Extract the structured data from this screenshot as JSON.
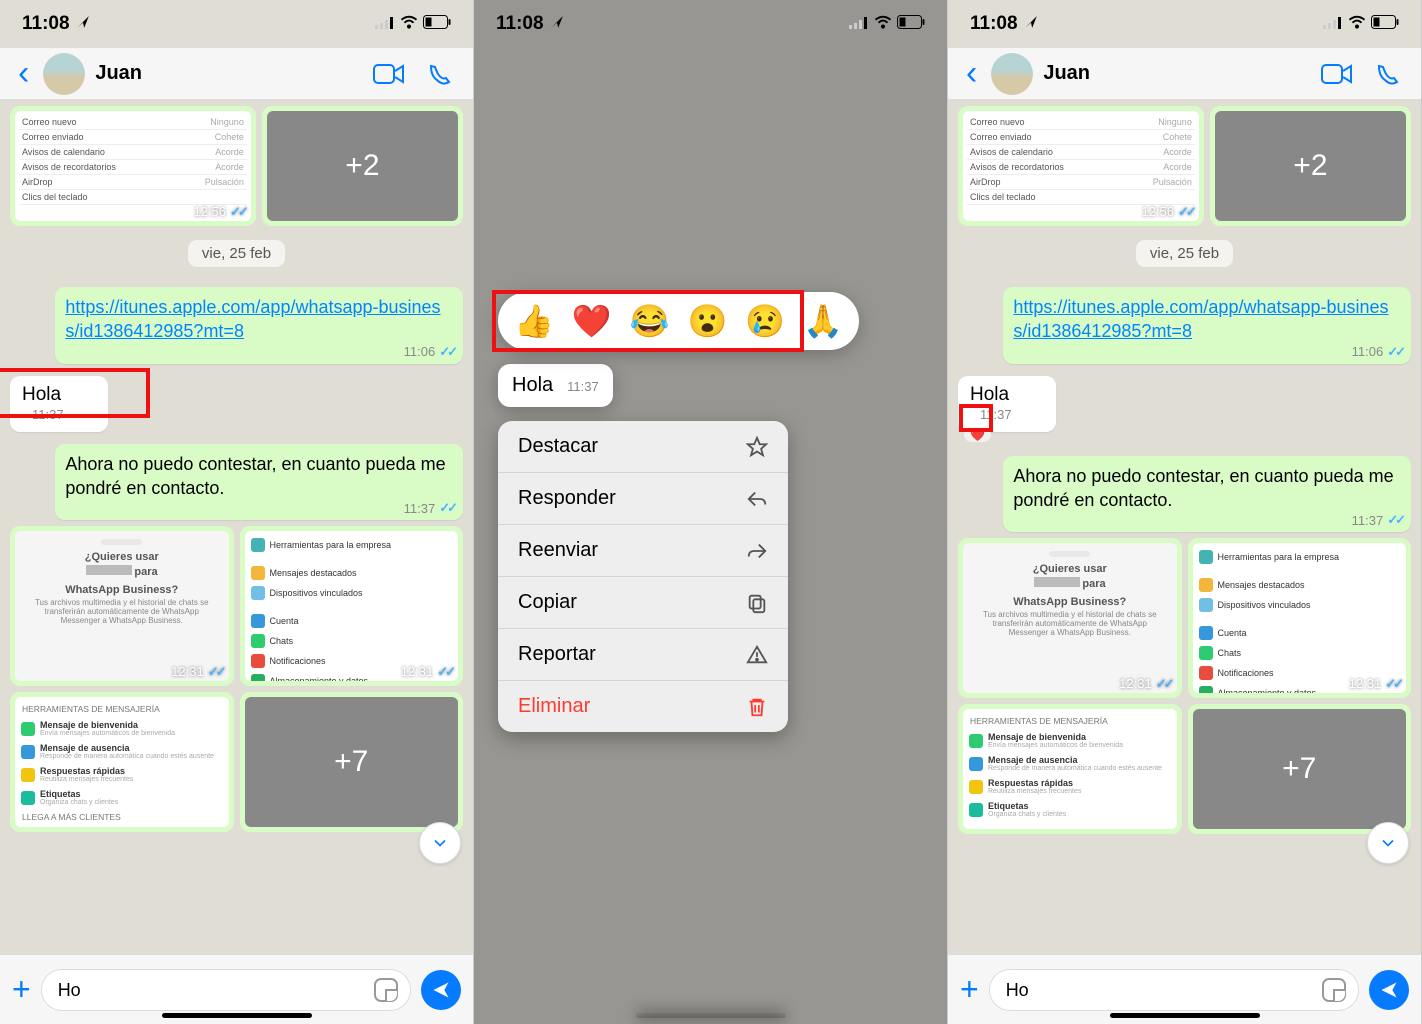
{
  "status": {
    "time": "11:08",
    "signalBars": 4,
    "battery": "low"
  },
  "contact": {
    "name": "Juan"
  },
  "dateHeader": "vie, 25 feb",
  "linkMessage": {
    "text": "https://itunes.apple.com/app/whatsapp-business/id1386412985?mt=8",
    "time": "11:06"
  },
  "hola": {
    "text": "Hola",
    "time": "11:37",
    "reaction": "❤️"
  },
  "autoReply": {
    "text": "Ahora no puedo contestar, en cuanto pueda me pondré en contacto.",
    "time": "11:37"
  },
  "topMedia": {
    "rows": [
      {
        "l": "Correo nuevo",
        "r": "Ninguno"
      },
      {
        "l": "Correo enviado",
        "r": "Cohete"
      },
      {
        "l": "Avisos de calendario",
        "r": "Acorde"
      },
      {
        "l": "Avisos de recordatorios",
        "r": "Acorde"
      },
      {
        "l": "AirDrop",
        "r": "Pulsación"
      },
      {
        "l": "Clics del teclado",
        "r": ""
      }
    ],
    "time": "12:56",
    "extraCount": "+2"
  },
  "middleMedia": {
    "left": {
      "title": "¿Quieres usar",
      "line2": "para",
      "line3": "WhatsApp Business?",
      "sub": "Tus archivos multimedia y el historial de chats se transferirán automáticamente de WhatsApp Messenger a WhatsApp Business.",
      "time": "12:31"
    },
    "right": {
      "rows": [
        {
          "color": "#43b3b3",
          "l": "Herramientas para la empresa"
        },
        {
          "color": "#f3b63c",
          "l": "Mensajes destacados"
        },
        {
          "color": "#71bfe5",
          "l": "Dispositivos vinculados"
        },
        {
          "color": "#3498db",
          "l": "Cuenta"
        },
        {
          "color": "#2ecc71",
          "l": "Chats"
        },
        {
          "color": "#e74c3c",
          "l": "Notificaciones"
        },
        {
          "color": "#27ae60",
          "l": "Almacenamiento y datos"
        }
      ],
      "time": "12:31"
    }
  },
  "bottomMedia": {
    "leftHeader": "HERRAMIENTAS DE MENSAJERÍA",
    "leftRows": [
      {
        "color": "#2ecc71",
        "t": "Mensaje de bienvenida",
        "s": "Envía mensajes automáticos de bienvenida"
      },
      {
        "color": "#3498db",
        "t": "Mensaje de ausencia",
        "s": "Responde de manera automática cuando estés ausente"
      },
      {
        "color": "#f1c40f",
        "t": "Respuestas rápidas",
        "s": "Reutiliza mensajes frecuentes"
      },
      {
        "color": "#1abc9c",
        "t": "Etiquetas",
        "s": "Organiza chats y clientes"
      }
    ],
    "leftFooter": "LLEGA A MÁS CLIENTES",
    "extraCount": "+7"
  },
  "input": {
    "text": "Ho"
  },
  "reactions": [
    "👍",
    "❤️",
    "😂",
    "😮",
    "😢",
    "🙏"
  ],
  "contextMenu": [
    {
      "label": "Destacar",
      "icon": "star"
    },
    {
      "label": "Responder",
      "icon": "reply"
    },
    {
      "label": "Reenviar",
      "icon": "forward"
    },
    {
      "label": "Copiar",
      "icon": "copy"
    },
    {
      "label": "Reportar",
      "icon": "warn"
    },
    {
      "label": "Eliminar",
      "icon": "trash",
      "danger": true
    }
  ]
}
